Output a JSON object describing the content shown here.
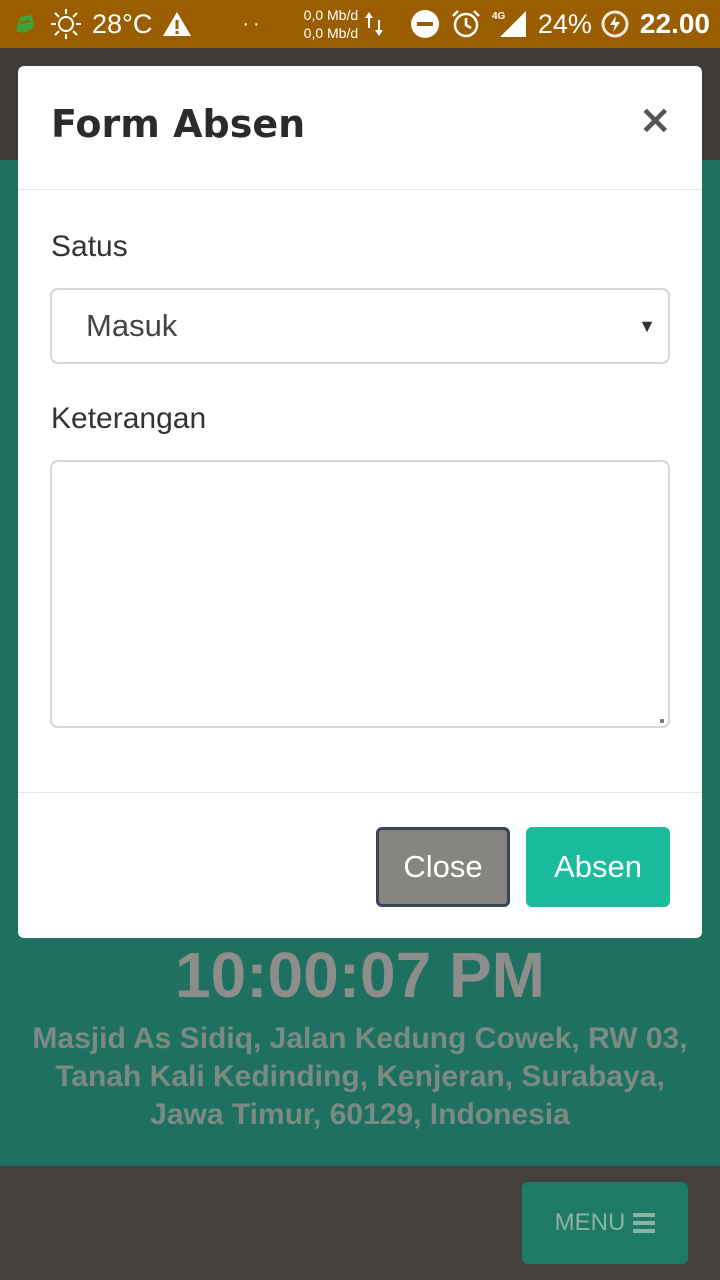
{
  "status_bar": {
    "temperature": "28°C",
    "dots": "··",
    "net_up": "0,0 Mb/d",
    "net_down": "0,0 Mb/d",
    "signal_label": "4G",
    "battery": "24%",
    "time": "22.00"
  },
  "modal": {
    "title": "Form Absen",
    "close_icon": "×",
    "status_label": "Satus",
    "status_selected": "Masuk",
    "keterangan_label": "Keterangan",
    "keterangan_value": "",
    "close_button": "Close",
    "absen_button": "Absen"
  },
  "background": {
    "clock": "10:00:07 PM",
    "address": "Masjid As Sidiq, Jalan Kedung Cowek, RW 03, Tanah Kali Kedinding, Kenjeran, Surabaya, Jawa Timur, 60129, Indonesia",
    "menu_label": "MENU"
  },
  "colors": {
    "status_bar": "#9a5e00",
    "accent": "#1abc9c",
    "background_green": "#1e7060"
  }
}
